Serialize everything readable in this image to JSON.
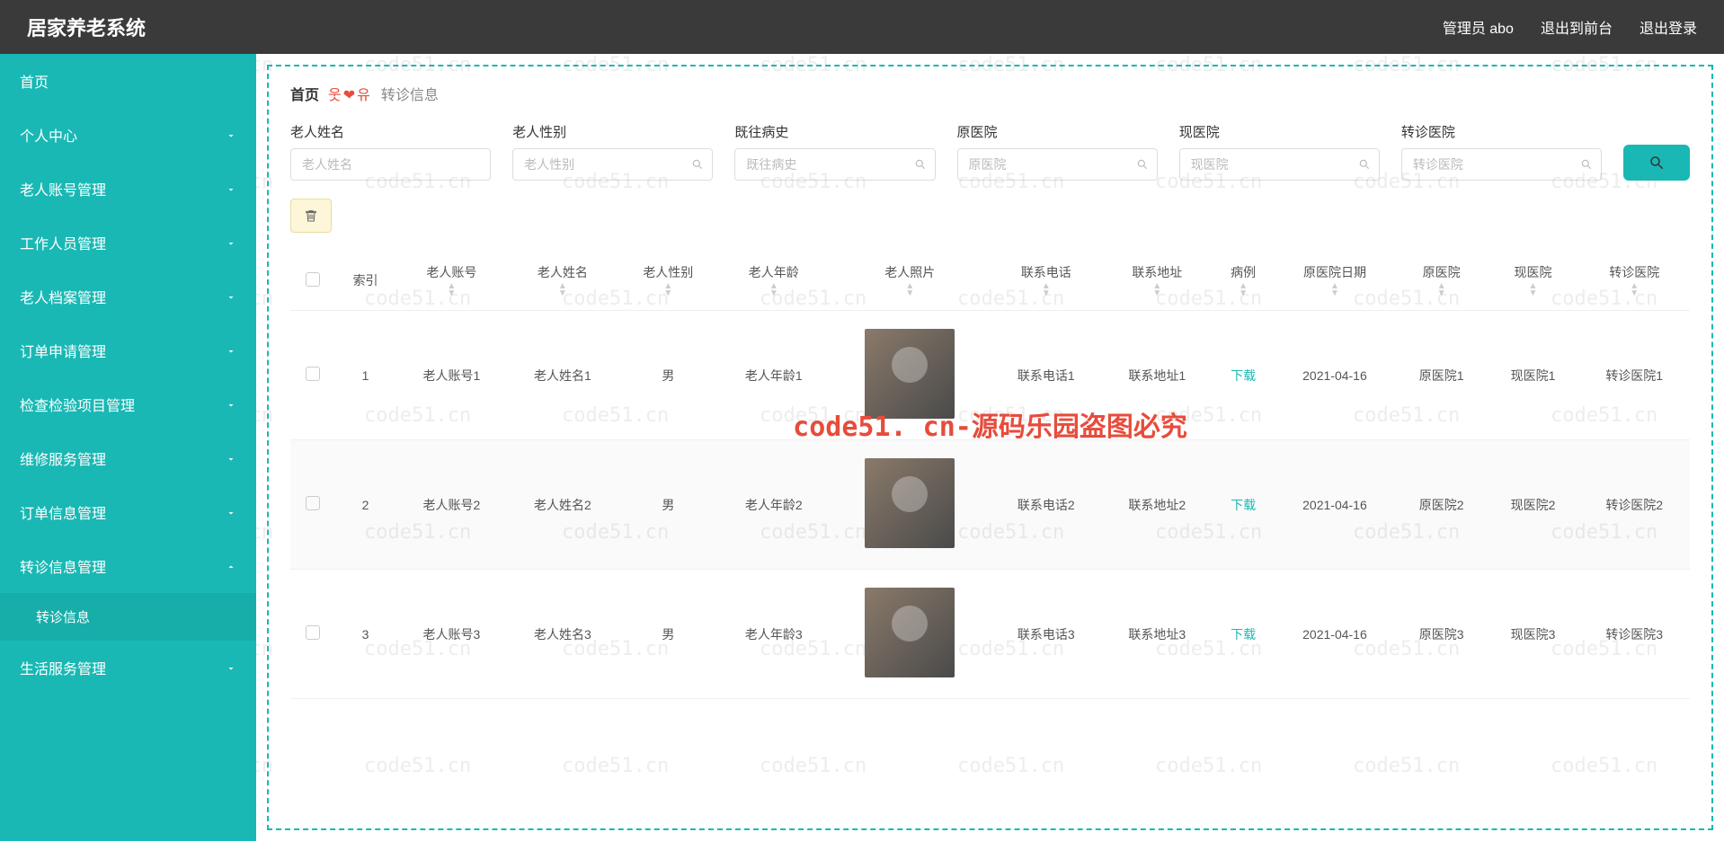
{
  "header": {
    "title": "居家养老系统",
    "admin": "管理员 abo",
    "frontend": "退出到前台",
    "logout": "退出登录"
  },
  "sidebar": {
    "items": [
      {
        "label": "首页",
        "expandable": false
      },
      {
        "label": "个人中心",
        "expandable": true
      },
      {
        "label": "老人账号管理",
        "expandable": true
      },
      {
        "label": "工作人员管理",
        "expandable": true
      },
      {
        "label": "老人档案管理",
        "expandable": true
      },
      {
        "label": "订单申请管理",
        "expandable": true
      },
      {
        "label": "检查检验项目管理",
        "expandable": true
      },
      {
        "label": "维修服务管理",
        "expandable": true
      },
      {
        "label": "订单信息管理",
        "expandable": true
      },
      {
        "label": "转诊信息管理",
        "expandable": true,
        "open": true,
        "children": [
          {
            "label": "转诊信息"
          }
        ]
      },
      {
        "label": "生活服务管理",
        "expandable": true
      }
    ]
  },
  "breadcrumb": {
    "home": "首页",
    "current": "转诊信息"
  },
  "filters": [
    {
      "label": "老人姓名",
      "placeholder": "老人姓名",
      "has_icon": false
    },
    {
      "label": "老人性别",
      "placeholder": "老人性别",
      "has_icon": true
    },
    {
      "label": "既往病史",
      "placeholder": "既往病史",
      "has_icon": true
    },
    {
      "label": "原医院",
      "placeholder": "原医院",
      "has_icon": true
    },
    {
      "label": "现医院",
      "placeholder": "现医院",
      "has_icon": true
    },
    {
      "label": "转诊医院",
      "placeholder": "转诊医院",
      "has_icon": true
    }
  ],
  "table": {
    "columns": [
      "",
      "索引",
      "老人账号",
      "老人姓名",
      "老人性别",
      "老人年龄",
      "老人照片",
      "联系电话",
      "联系地址",
      "病例",
      "原医院日期",
      "原医院",
      "现医院",
      "转诊医院"
    ],
    "download_label": "下载",
    "rows": [
      {
        "index": "1",
        "account": "老人账号1",
        "name": "老人姓名1",
        "gender": "男",
        "age": "老人年龄1",
        "phone": "联系电话1",
        "address": "联系地址1",
        "date": "2021-04-16",
        "origin": "原医院1",
        "current": "现医院1",
        "referral": "转诊医院1"
      },
      {
        "index": "2",
        "account": "老人账号2",
        "name": "老人姓名2",
        "gender": "男",
        "age": "老人年龄2",
        "phone": "联系电话2",
        "address": "联系地址2",
        "date": "2021-04-16",
        "origin": "原医院2",
        "current": "现医院2",
        "referral": "转诊医院2"
      },
      {
        "index": "3",
        "account": "老人账号3",
        "name": "老人姓名3",
        "gender": "男",
        "age": "老人年龄3",
        "phone": "联系电话3",
        "address": "联系地址3",
        "date": "2021-04-16",
        "origin": "原医院3",
        "current": "现医院3",
        "referral": "转诊医院3"
      }
    ]
  },
  "watermark": {
    "small": "code51.cn",
    "big": "code51. cn-源码乐园盗图必究"
  }
}
